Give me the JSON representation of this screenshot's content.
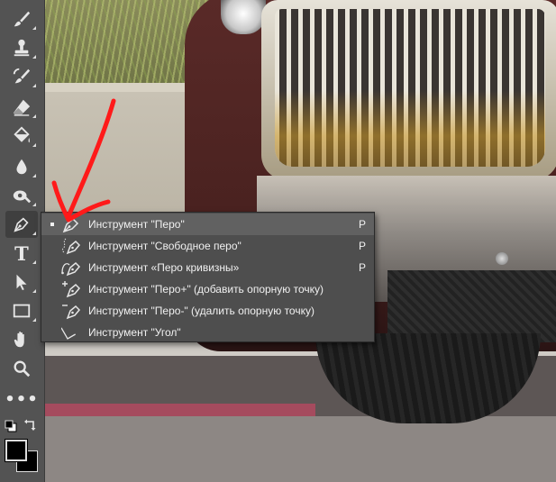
{
  "toolbar": {
    "tools": [
      {
        "name": "brush-tool",
        "icon": "brush-icon"
      },
      {
        "name": "clone-stamp-tool",
        "icon": "stamp-icon"
      },
      {
        "name": "history-brush-tool",
        "icon": "history-brush-icon"
      },
      {
        "name": "eraser-tool",
        "icon": "eraser-icon"
      },
      {
        "name": "paint-bucket-tool",
        "icon": "paint-bucket-icon"
      },
      {
        "name": "blur-tool",
        "icon": "drop-icon"
      },
      {
        "name": "dodge-tool",
        "icon": "dodge-icon"
      },
      {
        "name": "pen-tool",
        "icon": "pen-icon",
        "active": true
      },
      {
        "name": "type-tool",
        "icon": "type-icon",
        "glyph": "T"
      },
      {
        "name": "path-selection-tool",
        "icon": "arrow-pointer-icon"
      },
      {
        "name": "rectangle-tool",
        "icon": "rectangle-icon"
      },
      {
        "name": "hand-tool",
        "icon": "hand-icon"
      },
      {
        "name": "zoom-tool",
        "icon": "magnifier-icon"
      },
      {
        "name": "edit-toolbar",
        "icon": "more-dots-icon",
        "glyph": "•••"
      }
    ],
    "foreground_color": "#000000",
    "background_color": "#000000"
  },
  "flyout": {
    "items": [
      {
        "label": "Инструмент \"Перо\"",
        "shortcut": "P",
        "icon": "pen-icon",
        "selected": true
      },
      {
        "label": "Инструмент \"Свободное перо\"",
        "shortcut": "P",
        "icon": "freeform-pen-icon"
      },
      {
        "label": "Инструмент «Перо кривизны»",
        "shortcut": "P",
        "icon": "curvature-pen-icon"
      },
      {
        "label": "Инструмент \"Перо+\" (добавить опорную точку)",
        "shortcut": "",
        "icon": "add-anchor-point-icon"
      },
      {
        "label": "Инструмент \"Перо-\" (удалить опорную точку)",
        "shortcut": "",
        "icon": "delete-anchor-point-icon"
      },
      {
        "label": "Инструмент \"Угол\"",
        "shortcut": "",
        "icon": "convert-point-icon"
      }
    ]
  },
  "colors": {
    "toolbar_bg": "#535353",
    "menu_bg": "#4e4e4e",
    "menu_selected": "#616161",
    "annotation_arrow": "#ff1a1a"
  }
}
